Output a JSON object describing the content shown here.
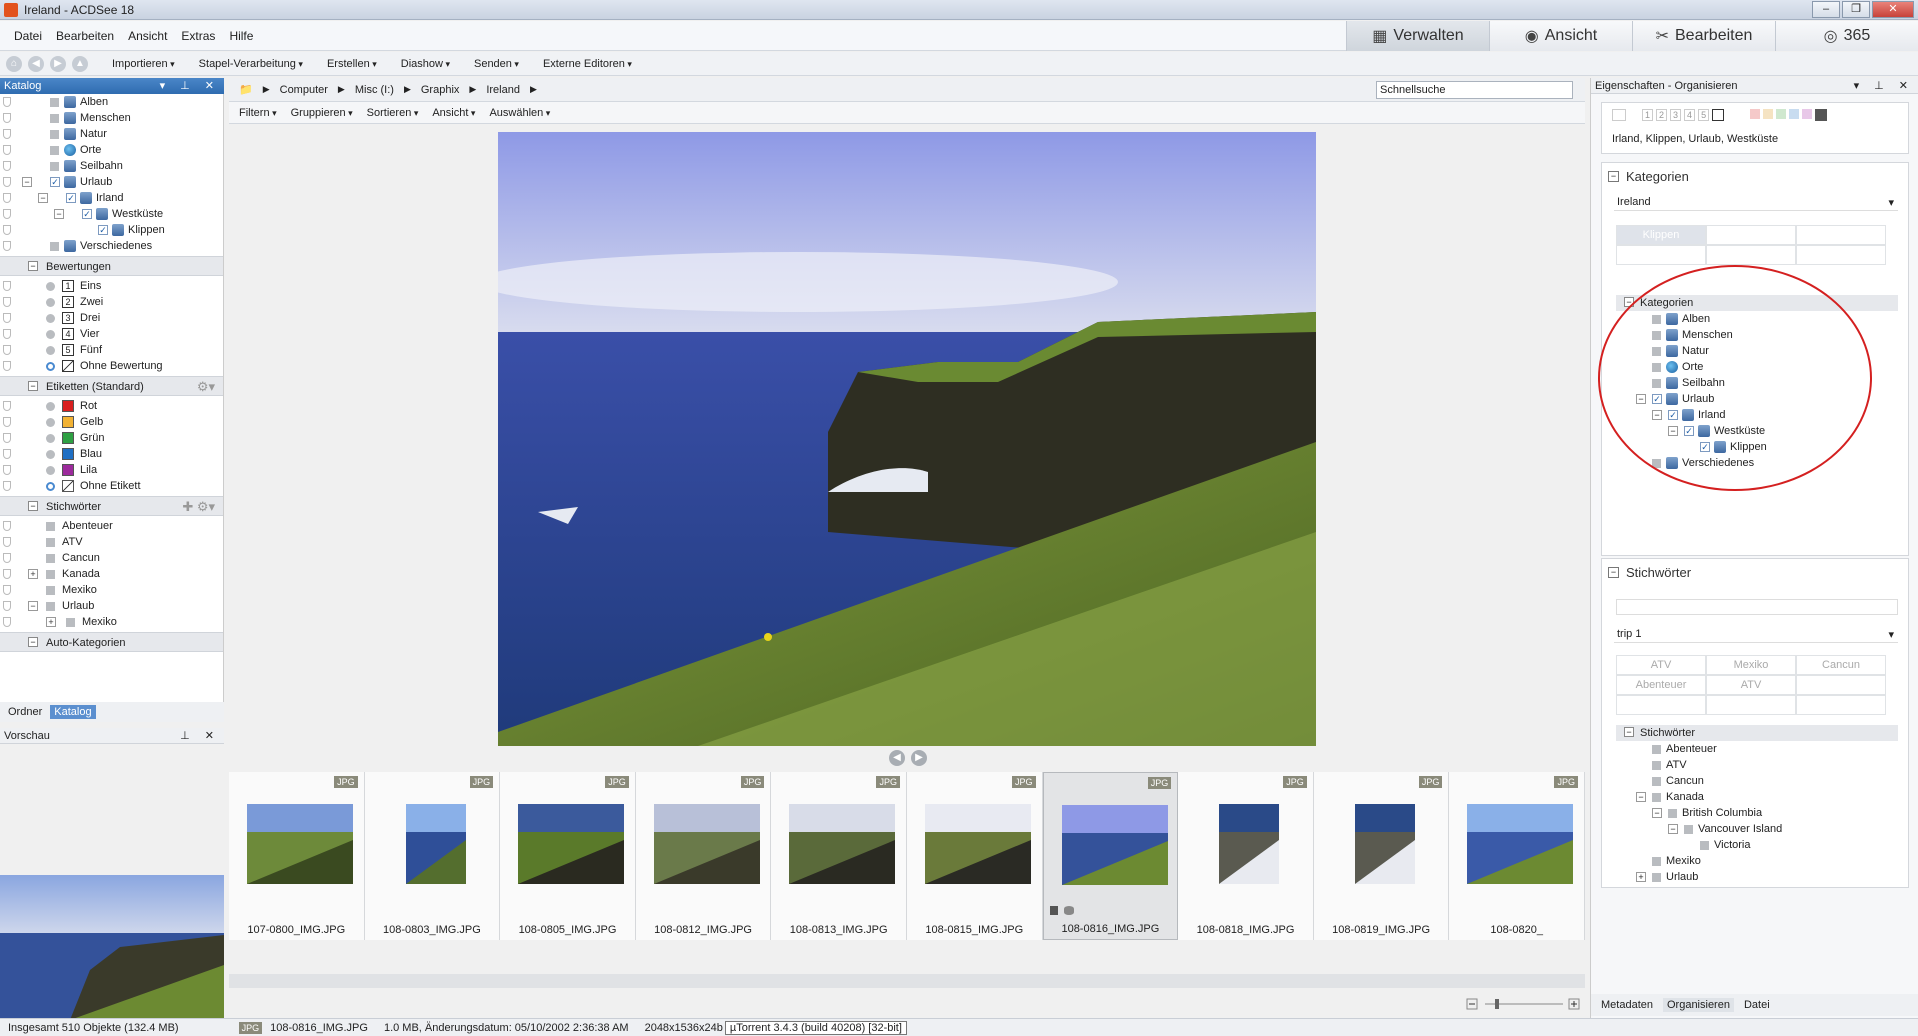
{
  "window": {
    "title": "Ireland - ACDSee 18",
    "controls": [
      "–",
      "❐",
      "✕"
    ]
  },
  "menu": [
    "Datei",
    "Bearbeiten",
    "Ansicht",
    "Extras",
    "Hilfe"
  ],
  "modes": [
    {
      "label": "Verwalten",
      "icon": "grid-icon"
    },
    {
      "label": "Ansicht",
      "icon": "eye-icon"
    },
    {
      "label": "Bearbeiten",
      "icon": "tools-icon"
    },
    {
      "label": "365",
      "icon": "365-icon"
    }
  ],
  "toolbar": [
    "Importieren",
    "Stapel-Verarbeitung",
    "Erstellen",
    "Diashow",
    "Senden",
    "Externe Editoren"
  ],
  "catalog": {
    "title": "Katalog",
    "categories": [
      {
        "label": "Alben",
        "indent": 0
      },
      {
        "label": "Menschen",
        "indent": 0
      },
      {
        "label": "Natur",
        "indent": 0
      },
      {
        "label": "Orte",
        "indent": 0
      },
      {
        "label": "Seilbahn",
        "indent": 0
      },
      {
        "label": "Urlaub",
        "indent": 0
      },
      {
        "label": "Irland",
        "indent": 1
      },
      {
        "label": "Westküste",
        "indent": 2
      },
      {
        "label": "Klippen",
        "indent": 3
      },
      {
        "label": "Verschiedenes",
        "indent": 0
      }
    ],
    "ratings_title": "Bewertungen",
    "ratings": [
      {
        "num": "1",
        "label": "Eins"
      },
      {
        "num": "2",
        "label": "Zwei"
      },
      {
        "num": "3",
        "label": "Drei"
      },
      {
        "num": "4",
        "label": "Vier"
      },
      {
        "num": "5",
        "label": "Fünf"
      },
      {
        "num": "",
        "label": "Ohne Bewertung"
      }
    ],
    "labels_title": "Etiketten (Standard)",
    "labels": [
      {
        "label": "Rot",
        "color": "#d81f1f"
      },
      {
        "label": "Gelb",
        "color": "#f2b233"
      },
      {
        "label": "Grün",
        "color": "#2ea043"
      },
      {
        "label": "Blau",
        "color": "#1f6fc4"
      },
      {
        "label": "Lila",
        "color": "#9c2a9c"
      },
      {
        "label": "Ohne Etikett",
        "color": ""
      }
    ],
    "keywords_title": "Stichwörter",
    "keywords": [
      {
        "label": "Abenteuer"
      },
      {
        "label": "ATV"
      },
      {
        "label": "Cancun"
      },
      {
        "label": "Kanada"
      },
      {
        "label": "Mexiko"
      },
      {
        "label": "Urlaub"
      },
      {
        "label": "Mexiko"
      }
    ],
    "auto_title": "Auto-Kategorien"
  },
  "left_tabs": [
    "Ordner",
    "Katalog"
  ],
  "preview_title": "Vorschau",
  "path": [
    "Computer",
    "Misc (I:)",
    "Graphix",
    "Ireland"
  ],
  "quicksearch": "Schnellsuche",
  "filterbar": [
    "Filtern",
    "Gruppieren",
    "Sortieren",
    "Ansicht",
    "Auswählen"
  ],
  "thumbnails": [
    {
      "name": "107-0800_IMG.JPG",
      "badge": "JPG",
      "selected": false
    },
    {
      "name": "108-0803_IMG.JPG",
      "badge": "JPG",
      "selected": false
    },
    {
      "name": "108-0805_IMG.JPG",
      "badge": "JPG",
      "selected": false
    },
    {
      "name": "108-0812_IMG.JPG",
      "badge": "JPG",
      "selected": false
    },
    {
      "name": "108-0813_IMG.JPG",
      "badge": "JPG",
      "selected": false
    },
    {
      "name": "108-0815_IMG.JPG",
      "badge": "JPG",
      "selected": false
    },
    {
      "name": "108-0816_IMG.JPG",
      "badge": "JPG",
      "selected": true
    },
    {
      "name": "108-0818_IMG.JPG",
      "badge": "JPG",
      "selected": false
    },
    {
      "name": "108-0819_IMG.JPG",
      "badge": "JPG",
      "selected": false
    },
    {
      "name": "108-0820_",
      "badge": "JPG",
      "selected": false
    }
  ],
  "right": {
    "title": "Eigenschaften - Organisieren",
    "rating_nums": [
      "1",
      "2",
      "3",
      "4",
      "5"
    ],
    "tags_summary": "Irland, Klippen, Urlaub, Westküste",
    "kategorien_title": "Kategorien",
    "kategorien_select": "Ireland",
    "kategorien_grid": [
      "Klippen",
      "",
      "",
      "",
      "",
      ""
    ],
    "tree_head": "Kategorien",
    "tree": [
      {
        "label": "Alben",
        "indent": 0
      },
      {
        "label": "Menschen",
        "indent": 0
      },
      {
        "label": "Natur",
        "indent": 0
      },
      {
        "label": "Orte",
        "indent": 0
      },
      {
        "label": "Seilbahn",
        "indent": 0
      },
      {
        "label": "Urlaub",
        "indent": 0
      },
      {
        "label": "Irland",
        "indent": 1
      },
      {
        "label": "Westküste",
        "indent": 2
      },
      {
        "label": "Klippen",
        "indent": 3
      },
      {
        "label": "Verschiedenes",
        "indent": 0
      }
    ],
    "stichwoerter_title": "Stichwörter",
    "stich_select": "trip 1",
    "stich_grid": [
      "ATV",
      "Mexiko",
      "Cancun",
      "Abenteuer",
      "ATV",
      "",
      "",
      "",
      ""
    ],
    "stich_head": "Stichwörter",
    "stich_tree": [
      {
        "label": "Abenteuer",
        "indent": 0
      },
      {
        "label": "ATV",
        "indent": 0
      },
      {
        "label": "Cancun",
        "indent": 0
      },
      {
        "label": "Kanada",
        "indent": 0
      },
      {
        "label": "British Columbia",
        "indent": 1
      },
      {
        "label": "Vancouver Island",
        "indent": 2
      },
      {
        "label": "Victoria",
        "indent": 3
      },
      {
        "label": "Mexiko",
        "indent": 0
      },
      {
        "label": "Urlaub",
        "indent": 0
      }
    ],
    "tabs": [
      "Metadaten",
      "Organisieren",
      "Datei"
    ]
  },
  "status": {
    "total": "Insgesamt 510 Objekte  (132.4 MB)",
    "badge": "JPG",
    "file": "108-0816_IMG.JPG",
    "info": "1.0 MB, Änderungsdatum: 05/10/2002 2:36:38 AM",
    "dims": "2048x1536x24b",
    "tooltip": "µTorrent 3.4.3  (build 40208) [32-bit]"
  }
}
